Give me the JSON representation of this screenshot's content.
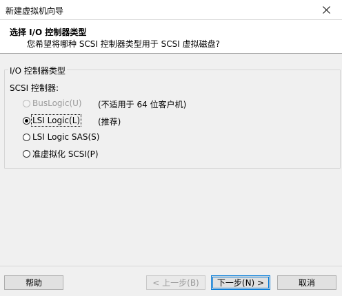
{
  "window": {
    "title": "新建虚拟机向导"
  },
  "header": {
    "title": "选择 I/O 控制器类型",
    "subtitle": "您希望将哪种 SCSI 控制器类型用于 SCSI 虚拟磁盘?"
  },
  "group": {
    "legend": "I/O 控制器类型",
    "subheading": "SCSI 控制器:",
    "options": [
      {
        "label": "BusLogic(U)",
        "note": "(不适用于 64 位客户机)",
        "selected": false,
        "enabled": false
      },
      {
        "label": "LSI Logic(L)",
        "note": "(推荐)",
        "selected": true,
        "enabled": true
      },
      {
        "label": "LSI Logic SAS(S)",
        "note": "",
        "selected": false,
        "enabled": true
      },
      {
        "label": "准虚拟化 SCSI(P)",
        "note": "",
        "selected": false,
        "enabled": true
      }
    ]
  },
  "buttons": {
    "help": "帮助",
    "back": "< 上一步(B)",
    "next": "下一步(N) >",
    "cancel": "取消"
  }
}
